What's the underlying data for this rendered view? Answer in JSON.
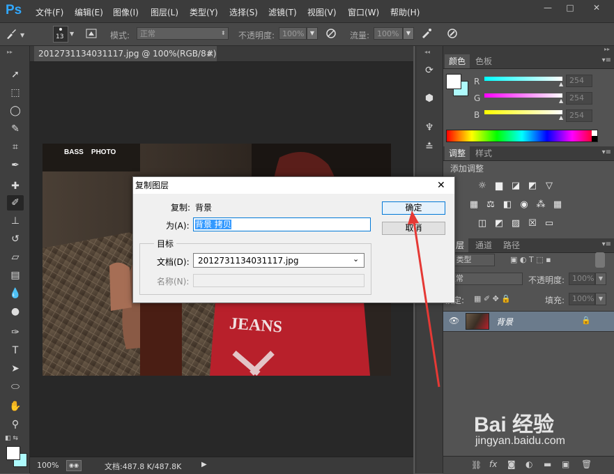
{
  "app": {
    "logo": "Ps"
  },
  "menu": [
    "文件(F)",
    "编辑(E)",
    "图像(I)",
    "图层(L)",
    "类型(Y)",
    "选择(S)",
    "滤镜(T)",
    "视图(V)",
    "窗口(W)",
    "帮助(H)"
  ],
  "window_controls": {
    "minimize": "—",
    "maximize": "□",
    "close": "✕"
  },
  "options": {
    "brush_size": "13",
    "mode_label": "模式:",
    "mode_value": "正常",
    "opacity_label": "不透明度:",
    "opacity_value": "100%",
    "flow_label": "流量:",
    "flow_value": "100%"
  },
  "document": {
    "tab_title": "2012731134031117.jpg @ 100%(RGB/8#)",
    "tab_close": "×",
    "photo_watermark_line1": "BASS    PHOTO",
    "photo_text_jeans": "JEANS",
    "zoom": "100%",
    "doc_size": "文档:487.8 K/487.8K"
  },
  "color_panel": {
    "tabs": [
      "颜色",
      "色板"
    ],
    "channels": [
      {
        "label": "R",
        "value": "254",
        "color": "#00e5ff"
      },
      {
        "label": "G",
        "value": "254",
        "color": "#ff2cff"
      },
      {
        "label": "B",
        "value": "254",
        "color": "#ffff00"
      }
    ]
  },
  "adjust_panel": {
    "tabs": [
      "调整",
      "样式"
    ],
    "title": "添加调整"
  },
  "layers_panel": {
    "tabs": [
      "图层",
      "通道",
      "路径"
    ],
    "kind_label": "类型",
    "blend_mode": "正常",
    "opacity_label": "不透明度:",
    "opacity_value": "100%",
    "lock_label": "锁定:",
    "fill_label": "填充:",
    "fill_value": "100%",
    "layers": [
      {
        "name": "背景",
        "visible": true,
        "locked": true
      }
    ]
  },
  "dialog": {
    "title": "复制图层",
    "copy_label": "复制:",
    "copy_value": "背景",
    "as_label": "为(A):",
    "as_value": "背景 拷贝",
    "ok_label": "确定",
    "cancel_label": "取消",
    "target_group": "目标",
    "document_label": "文档(D):",
    "document_value": "2012731134031117.jpg",
    "name_label": "名称(N):",
    "name_value": "",
    "close": "✕"
  },
  "watermark": {
    "brand": "Bai 经验",
    "url": "jingyan.baidu.com"
  },
  "colors": {
    "accent": "#31a8ff",
    "annotation": "#e53935",
    "selection": "#3399ff"
  }
}
